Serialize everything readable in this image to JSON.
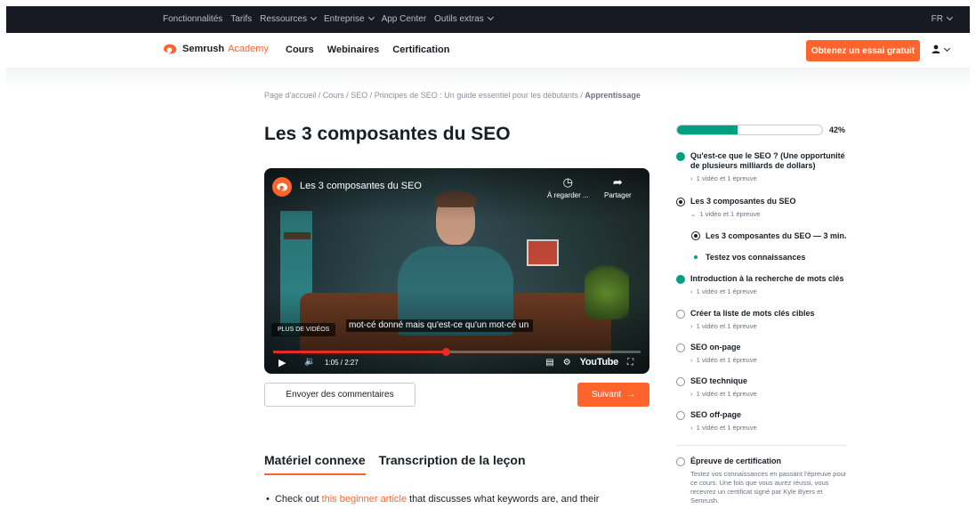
{
  "topbar": {
    "nav": [
      {
        "label": "Fonctionnalités",
        "dropdown": false
      },
      {
        "label": "Tarifs",
        "dropdown": false
      },
      {
        "label": "Ressources",
        "dropdown": true
      },
      {
        "label": "Entreprise",
        "dropdown": true
      },
      {
        "label": "App Center",
        "dropdown": false
      },
      {
        "label": "Outils extras",
        "dropdown": true
      }
    ],
    "lang": "FR"
  },
  "header": {
    "brand": "Semrush",
    "brand_suffix": "Academy",
    "nav": [
      "Cours",
      "Webinaires",
      "Certification"
    ],
    "cta": "Obtenez un essai gratuit"
  },
  "breadcrumb": {
    "path": "Page d'accueil / Cours / SEO / Principes de SEO : Un guide essentiel pour les débutants / ",
    "current": "Apprentissage"
  },
  "lesson": {
    "title": "Les 3 composantes du SEO"
  },
  "video": {
    "title": "Les 3 composantes du SEO",
    "watch_later": "À regarder ...",
    "share": "Partager",
    "more_videos": "PLUS DE VIDÉOS",
    "caption": "mot-cé donné mais qu'est-ce qu'un mot-cé un",
    "time": "1:05 / 2:27",
    "progress": 0.47,
    "youtube_label": "YouTube"
  },
  "buttons": {
    "feedback": "Envoyer des commentaires",
    "next": "Suivant",
    "next_arrow": "→"
  },
  "tabs": [
    "Matériel connexe",
    "Transcription de la leçon"
  ],
  "content": {
    "bullet_prefix": "Check out ",
    "bullet_link": "this beginner article",
    "bullet_suffix": " that discusses what keywords are, and their"
  },
  "sidebar": {
    "progress_pct": 42,
    "progress_label": "42%",
    "colors": {
      "done": "#009f81",
      "accent": "#ff642d"
    },
    "items": [
      {
        "title": "Qu'est-ce que le SEO ? (Une opportunité de plusieurs milliards de dollars)",
        "sub": "1 vidéo et 1 épreuve",
        "state": "done",
        "expanded": false
      },
      {
        "title": "Les 3 composantes du SEO",
        "sub": "1 vidéo et 1 épreuve",
        "state": "current",
        "expanded": true
      },
      {
        "title": "Introduction à la recherche de mots clés",
        "sub": "1 vidéo et 1 épreuve",
        "state": "done",
        "expanded": false
      },
      {
        "title": "Créer ta liste de mots clés cibles",
        "sub": "1 vidéo et 1 épreuve",
        "state": "empty",
        "expanded": false
      },
      {
        "title": "SEO on-page",
        "sub": "1 vidéo et 1 épreuve",
        "state": "empty",
        "expanded": false
      },
      {
        "title": "SEO technique",
        "sub": "1 vidéo et 1 épreuve",
        "state": "empty",
        "expanded": false
      },
      {
        "title": "SEO off-page",
        "sub": "1 vidéo et 1 épreuve",
        "state": "empty",
        "expanded": false
      }
    ],
    "subitems": [
      {
        "title": "Les 3 composantes du SEO — 3 min.",
        "state": "current"
      },
      {
        "title": "Testez vos connaissances",
        "state": "done"
      }
    ],
    "certification": {
      "title": "Épreuve de certification",
      "desc": "Testez vos connaissances en passant l'épreuve pour ce cours. Une fois que vous aurez réussi, vous recevrez un certificat signé par Kyle Byers et Semrush."
    }
  }
}
